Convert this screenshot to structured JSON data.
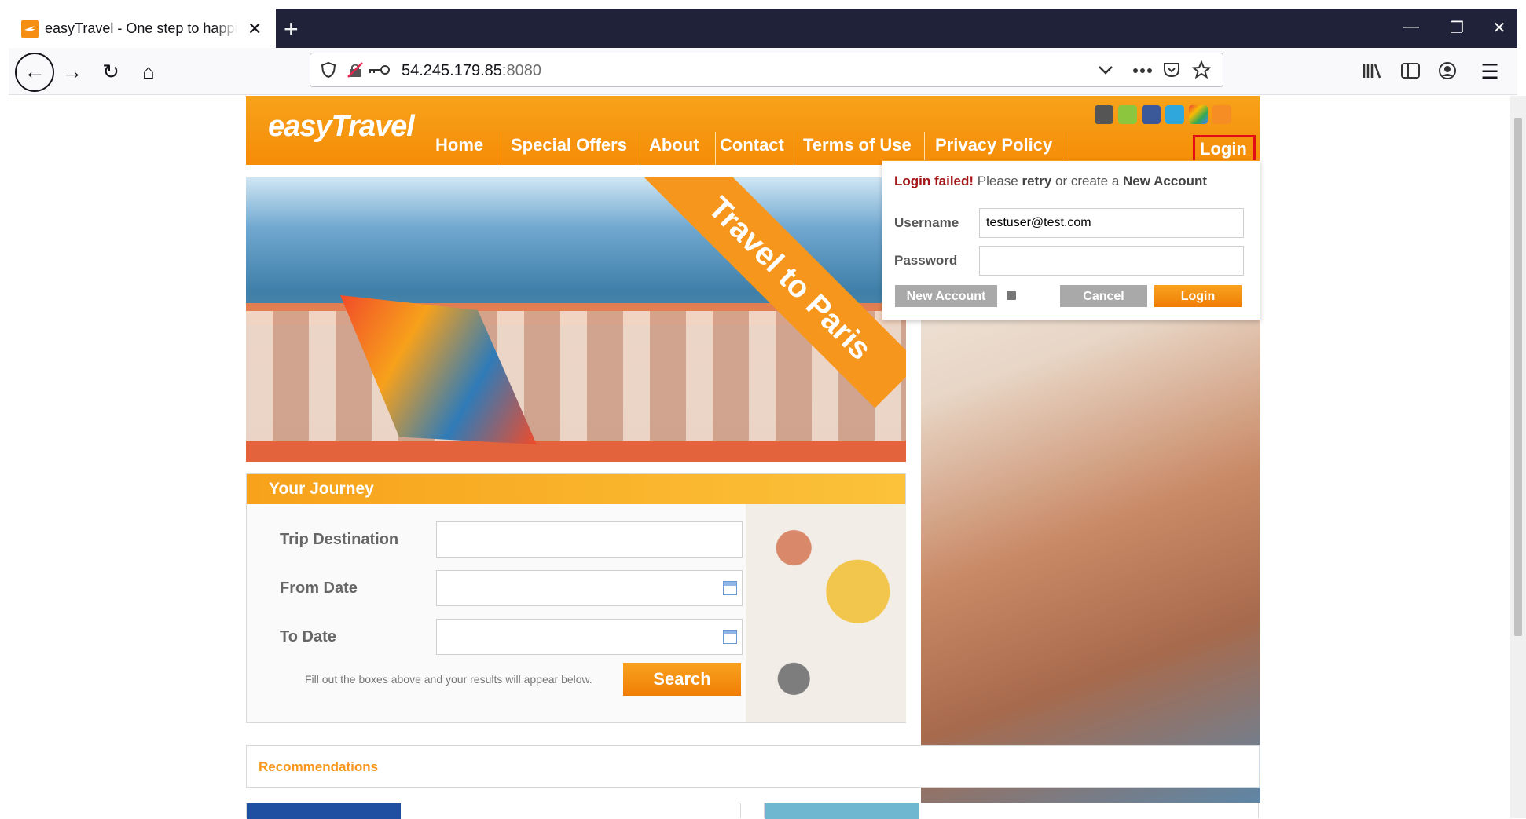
{
  "browser": {
    "tab_title": "easyTravel - One step to happiness",
    "close_tab_glyph": "✕",
    "new_tab_glyph": "+",
    "url_host": "54.245.179.85",
    "url_port": ":8080",
    "window_controls": {
      "minimize": "—",
      "restore": "❐",
      "close": "✕"
    },
    "nav_icons": {
      "back": "←",
      "forward": "→",
      "reload": "↻",
      "home": "⌂",
      "menu": "☰"
    }
  },
  "site": {
    "logo_text": "easyTravel",
    "nav": [
      "Home",
      "Special Offers",
      "About",
      "Contact",
      "Terms of Use",
      "Privacy Policy"
    ],
    "login_link": "Login",
    "social_icons": [
      "apple-icon",
      "android-icon",
      "facebook-icon",
      "twitter-icon",
      "google-icon",
      "rss-icon"
    ],
    "colors": {
      "brand_orange": "#f7961c",
      "error_red": "#a4161a",
      "highlight_border": "#e30b17"
    }
  },
  "hero": {
    "banner_text": "Travel to Paris"
  },
  "journey": {
    "title": "Your Journey",
    "trip_destination_label": "Trip Destination",
    "from_date_label": "From Date",
    "to_date_label": "To Date",
    "hint": "Fill out the boxes above and your results will appear below.",
    "search_button": "Search"
  },
  "recommendations": {
    "title": "Recommendations"
  },
  "login_popup": {
    "failed": "Login failed!",
    "please": " Please ",
    "retry": "retry",
    "or_create": " or create a ",
    "new_account_text": "New Account",
    "username_label": "Username",
    "username_value": "testuser@test.com",
    "password_label": "Password",
    "password_value": "",
    "new_account_button": "New Account",
    "cancel_button": "Cancel",
    "login_button": "Login"
  }
}
